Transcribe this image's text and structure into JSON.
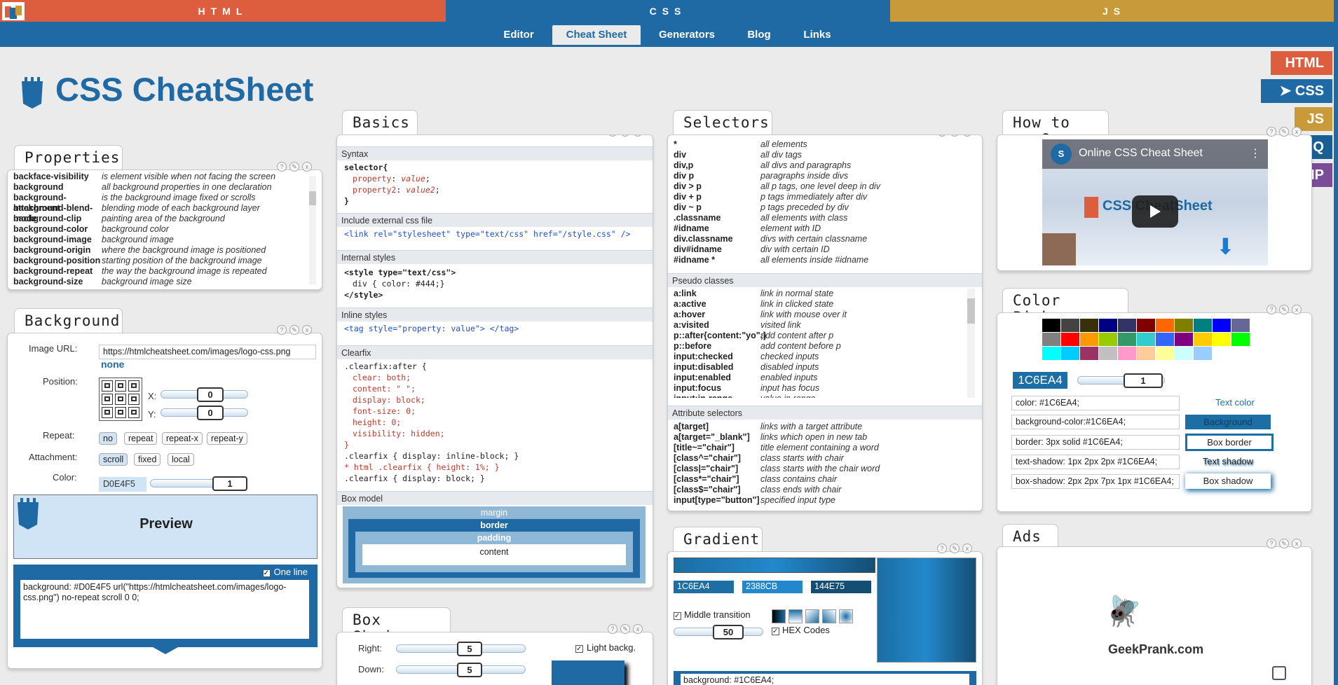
{
  "topbar": {
    "html": "HTML",
    "css": "CSS",
    "js": "JS",
    "colors": {
      "html": "#dc5e3f",
      "css": "#1f6aa5",
      "js": "#c99a3a"
    }
  },
  "nav": [
    "Editor",
    "Cheat Sheet",
    "Generators",
    "Blog",
    "Links"
  ],
  "title": "CSS CheatSheet",
  "side": [
    "HTML",
    "➤ CSS",
    "JS",
    "jQ",
    "AMP"
  ],
  "props": {
    "tab": "Properties",
    "rows": [
      [
        "backface-visibility",
        "is element visible when not facing the screen"
      ],
      [
        "background",
        "all background properties in one declaration"
      ],
      [
        "background-attachment",
        "is the background image fixed or scrolls"
      ],
      [
        "background-blend-mode",
        "blending mode of each background layer"
      ],
      [
        "background-clip",
        "painting area of the background"
      ],
      [
        "background-color",
        "background color"
      ],
      [
        "background-image",
        "background image"
      ],
      [
        "background-origin",
        "where the background image is positioned"
      ],
      [
        "background-position",
        "starting position of the background image"
      ],
      [
        "background-repeat",
        "the way the background image is repeated"
      ],
      [
        "background-size",
        "background image size"
      ]
    ]
  },
  "bg": {
    "tab": "Background",
    "image_label": "Image URL:",
    "image_url": "https://htmlcheatsheet.com/images/logo-css.png",
    "none": "none",
    "position_label": "Position:",
    "x_label": "X:",
    "x": "0",
    "y_label": "Y:",
    "y": "0",
    "repeat_label": "Repeat:",
    "repeat": [
      "no",
      "repeat",
      "repeat-x",
      "repeat-y"
    ],
    "attach_label": "Attachment:",
    "attach": [
      "scroll",
      "fixed",
      "local"
    ],
    "color_label": "Color:",
    "color": "D0E4F5",
    "opacity": "1",
    "preview": "Preview",
    "oneline": "One line",
    "code": "background: #D0E4F5 url(\"https://htmlcheatsheet.com/images/logo-css.png\") no-repeat scroll 0 0;"
  },
  "basics": {
    "tab": "Basics",
    "syntax": "Syntax",
    "ext": "Include external css file",
    "internal": "Internal styles",
    "inline": "Inline styles",
    "clearfix": "Clearfix",
    "box": "Box model",
    "margin": "margin",
    "border": "border",
    "padding": "padding",
    "content": "content",
    "syntax_code": [
      "selector{",
      "property",
      "value",
      "property2",
      "value2",
      "}"
    ],
    "link_code": "<link rel=\"stylesheet\" type=\"text/css\" href=\"/style.css\" />",
    "internal_code": [
      "<style type=\"text/css\">",
      "div { color: #444;}",
      "</style>"
    ],
    "inline_code": "<tag style=\"property: value\"> </tag>",
    "clearfix_code": [
      ".clearfix:after {",
      "clear: both;",
      "content: \" \";",
      "display: block;",
      "font-size: 0;",
      "height: 0;",
      "visibility: hidden;",
      "}",
      ".clearfix { display: inline-block; }",
      "* html .clearfix { height: 1%; }",
      ".clearfix { display: block; }"
    ]
  },
  "selectors": {
    "tab": "Selectors",
    "rows": [
      [
        "*",
        "all elements"
      ],
      [
        "div",
        "all div tags"
      ],
      [
        "div,p",
        "all divs and paragraphs"
      ],
      [
        "div p",
        "paragraphs inside divs"
      ],
      [
        "div > p",
        "all p tags, one level deep in div"
      ],
      [
        "div + p",
        "p tags immediately after div"
      ],
      [
        "div ~ p",
        "p tags preceded by div"
      ],
      [
        ".classname",
        "all elements with class"
      ],
      [
        "#idname",
        "element with ID"
      ],
      [
        "div.classname",
        "divs with certain classname"
      ],
      [
        "div#idname",
        "div with certain ID"
      ],
      [
        "#idname *",
        "all elements inside #idname"
      ]
    ],
    "pseudo_label": "Pseudo classes",
    "pseudo": [
      [
        "a:link",
        "link in normal state"
      ],
      [
        "a:active",
        "link in clicked state"
      ],
      [
        "a:hover",
        "link with mouse over it"
      ],
      [
        "a:visited",
        "visited link"
      ],
      [
        "p::after{content:\"yo\";}",
        "add content after p"
      ],
      [
        "p::before",
        "add content before p"
      ],
      [
        "input:checked",
        "checked inputs"
      ],
      [
        "input:disabled",
        "disabled inputs"
      ],
      [
        "input:enabled",
        "enabled inputs"
      ],
      [
        "input:focus",
        "input has focus"
      ],
      [
        "input:in-range",
        "value in range"
      ]
    ],
    "attr_label": "Attribute selectors",
    "attr": [
      [
        "a[target]",
        "links with a target attribute"
      ],
      [
        "a[target=\"_blank\"]",
        "links which open in new tab"
      ],
      [
        "[title~=\"chair\"]",
        "title element containing a word"
      ],
      [
        "[class^=\"chair\"]",
        "class starts with chair"
      ],
      [
        "[class|=\"chair\"]",
        "class starts with the chair word"
      ],
      [
        "[class*=\"chair\"]",
        "class contains chair"
      ],
      [
        "[class$=\"chair\"]",
        "class ends with chair"
      ],
      [
        "input[type=\"button\"]",
        "specified input type"
      ]
    ]
  },
  "howto": {
    "tab": "How to use?",
    "video_title": "Online CSS Cheat Sheet",
    "video_logo": "CSS CheatSheet"
  },
  "picker": {
    "tab": "Color Picker",
    "hex": "1C6EA4",
    "opacity": "1",
    "color": "color: #1C6EA4;",
    "text_color": "Text color",
    "bgc": "background-color:#1C6EA4;",
    "background": "Background",
    "border": "border: 3px solid #1C6EA4;",
    "box_border": "Box border",
    "tshadow": "text-shadow: 1px 2px 2px #1C6EA4;",
    "text_shadow": "Text shadow",
    "bshadow": "box-shadow: 2px 2px 7px 1px #1C6EA4;",
    "box_shadow": "Box shadow",
    "palette": [
      "#000000",
      "#434343",
      "#3a2f0b",
      "#000080",
      "#333366",
      "#800000",
      "#ff6600",
      "#808000",
      "#008080",
      "#0000ff",
      "#666699",
      "#808080",
      "#ff0000",
      "#ff9900",
      "#99cc00",
      "#339966",
      "#33cccc",
      "#3366ff",
      "#800080",
      "#ffcc00",
      "#ffff00",
      "#00ff00",
      "#00ffff",
      "#00ccff",
      "#993366",
      "#c0c0c0",
      "#ff99cc",
      "#ffcc99",
      "#ffff99",
      "#ccffff",
      "#99ccff"
    ]
  },
  "gradient": {
    "tab": "Gradient",
    "c1": "1C6EA4",
    "c2": "2388CB",
    "c3": "144E75",
    "middle": "Middle transition",
    "hex": "HEX Codes",
    "value": "50",
    "code": "background: #1C6EA4;"
  },
  "boxshadow": {
    "tab": "Box Shadow",
    "right": "Right:",
    "right_val": "5",
    "down": "Down:",
    "down_val": "5",
    "light": "Light backg."
  },
  "ads": {
    "tab": "Ads",
    "brand": "GeekPrank.com"
  }
}
